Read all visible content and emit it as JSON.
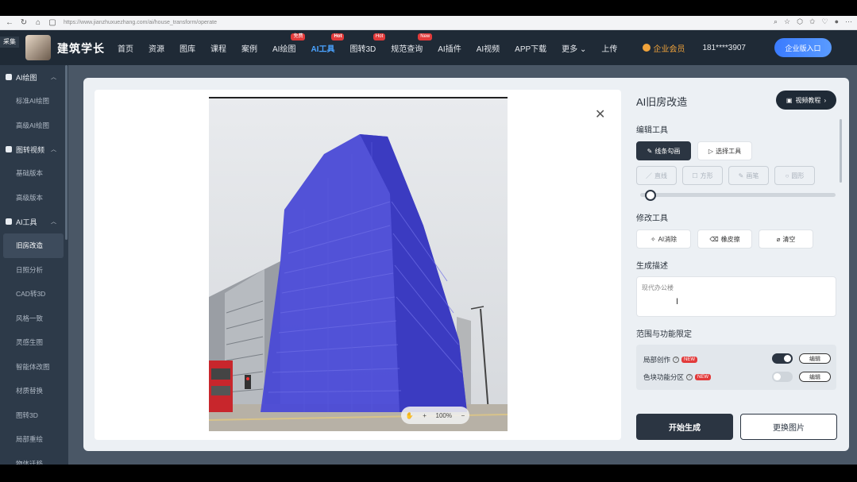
{
  "browser": {
    "url": "https://www.jianzhuxuezhang.com/ai/house_transform/operate"
  },
  "header": {
    "collect_tag": "采集",
    "brand": "建筑学长",
    "nav": [
      {
        "label": "首页",
        "badge": ""
      },
      {
        "label": "资源",
        "badge": ""
      },
      {
        "label": "图库",
        "badge": ""
      },
      {
        "label": "课程",
        "badge": ""
      },
      {
        "label": "案例",
        "badge": ""
      },
      {
        "label": "AI绘图",
        "badge": "免费"
      },
      {
        "label": "AI工具",
        "badge": "Hot"
      },
      {
        "label": "图转3D",
        "badge": "Hot"
      },
      {
        "label": "规范查询",
        "badge": "New"
      },
      {
        "label": "AI插件",
        "badge": ""
      },
      {
        "label": "AI视频",
        "badge": ""
      },
      {
        "label": "APP下载",
        "badge": ""
      },
      {
        "label": "更多",
        "badge": ""
      },
      {
        "label": "上传",
        "badge": ""
      }
    ],
    "vip": "企业会员",
    "phone": "181****3907",
    "enterprise_btn": "企业版入口"
  },
  "sidebar": {
    "groups": [
      {
        "label": "AI绘图",
        "items": [
          "标准AI绘图",
          "高级AI绘图"
        ]
      },
      {
        "label": "图转视频",
        "items": [
          "基础版本",
          "高级版本"
        ]
      },
      {
        "label": "AI工具",
        "items": [
          "旧房改造",
          "日照分析",
          "CAD转3D",
          "风格一致",
          "灵感生图",
          "智能体改图",
          "材质替换",
          "图转3D",
          "局部重绘",
          "物体迁移"
        ]
      }
    ],
    "active_item": "旧房改造"
  },
  "canvas": {
    "zoom": "100%"
  },
  "panel": {
    "title": "AI旧房改造",
    "video_btn": "视频教程",
    "edit_tools_label": "编辑工具",
    "tool_line_draw": "线条勾画",
    "tool_select": "选择工具",
    "shape_line": "直线",
    "shape_rect": "方形",
    "shape_brush": "画笔",
    "shape_circle": "圆形",
    "brush_size": 0.03,
    "modify_tools_label": "修改工具",
    "modify_ai_erase": "AI消除",
    "modify_eraser": "橡皮擦",
    "modify_clear": "清空",
    "desc_label": "生成描述",
    "desc_value": "现代办公楼",
    "scope_label": "范围与功能限定",
    "opt_local": "局部创作",
    "opt_color": "色块功能分区",
    "new_badge": "NEW",
    "edit_label": "编辑",
    "opt_local_on": true,
    "opt_color_on": false,
    "generate_btn": "开始生成",
    "replace_btn": "更换图片"
  }
}
